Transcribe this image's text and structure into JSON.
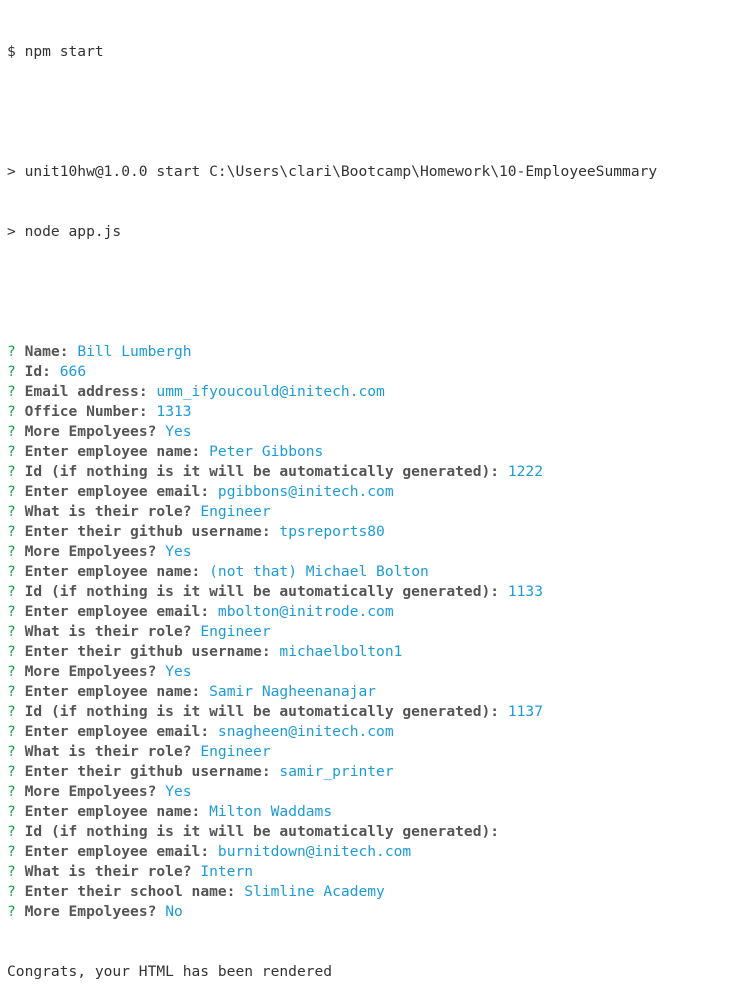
{
  "header": {
    "prompt_line": "$ npm start",
    "script_line": "> unit10hw@1.0.0 start C:\\Users\\clari\\Bootcamp\\Homework\\10-EmployeeSummary",
    "node_line": "> node app.js"
  },
  "qa": [
    {
      "mark": "?",
      "label": "Name:",
      "answer": "Bill Lumbergh"
    },
    {
      "mark": "?",
      "label": "Id:",
      "answer": "666"
    },
    {
      "mark": "?",
      "label": "Email address:",
      "answer": "umm_ifyoucould@initech.com"
    },
    {
      "mark": "?",
      "label": "Office Number:",
      "answer": "1313"
    },
    {
      "mark": "?",
      "label": "More Empolyees?",
      "answer": "Yes"
    },
    {
      "mark": "?",
      "label": "Enter employee name:",
      "answer": "Peter Gibbons"
    },
    {
      "mark": "?",
      "label": "Id (if nothing is it will be automatically generated):",
      "answer": "1222"
    },
    {
      "mark": "?",
      "label": "Enter employee email:",
      "answer": "pgibbons@initech.com"
    },
    {
      "mark": "?",
      "label": "What is their role?",
      "answer": "Engineer"
    },
    {
      "mark": "?",
      "label": "Enter their github username:",
      "answer": "tpsreports80"
    },
    {
      "mark": "?",
      "label": "More Empolyees?",
      "answer": "Yes"
    },
    {
      "mark": "?",
      "label": "Enter employee name:",
      "answer": "(not that) Michael Bolton"
    },
    {
      "mark": "?",
      "label": "Id (if nothing is it will be automatically generated):",
      "answer": "1133"
    },
    {
      "mark": "?",
      "label": "Enter employee email:",
      "answer": "mbolton@initrode.com"
    },
    {
      "mark": "?",
      "label": "What is their role?",
      "answer": "Engineer"
    },
    {
      "mark": "?",
      "label": "Enter their github username:",
      "answer": "michaelbolton1"
    },
    {
      "mark": "?",
      "label": "More Empolyees?",
      "answer": "Yes"
    },
    {
      "mark": "?",
      "label": "Enter employee name:",
      "answer": "Samir Nagheenanajar"
    },
    {
      "mark": "?",
      "label": "Id (if nothing is it will be automatically generated):",
      "answer": "1137"
    },
    {
      "mark": "?",
      "label": "Enter employee email:",
      "answer": "snagheen@initech.com"
    },
    {
      "mark": "?",
      "label": "What is their role?",
      "answer": "Engineer"
    },
    {
      "mark": "?",
      "label": "Enter their github username:",
      "answer": "samir_printer"
    },
    {
      "mark": "?",
      "label": "More Empolyees?",
      "answer": "Yes"
    },
    {
      "mark": "?",
      "label": "Enter employee name:",
      "answer": "Milton Waddams"
    },
    {
      "mark": "?",
      "label": "Id (if nothing is it will be automatically generated):",
      "answer": ""
    },
    {
      "mark": "?",
      "label": "Enter employee email:",
      "answer": "burnitdown@initech.com"
    },
    {
      "mark": "?",
      "label": "What is their role?",
      "answer": "Intern"
    },
    {
      "mark": "?",
      "label": "Enter their school name:",
      "answer": "Slimline Academy"
    },
    {
      "mark": "?",
      "label": "More Empolyees?",
      "answer": "No"
    }
  ],
  "footer": {
    "done_line": "Congrats, your HTML has been rendered"
  },
  "colors": {
    "question_mark": "#16a34a",
    "answer": "#1e9bd7",
    "text": "#333333"
  }
}
